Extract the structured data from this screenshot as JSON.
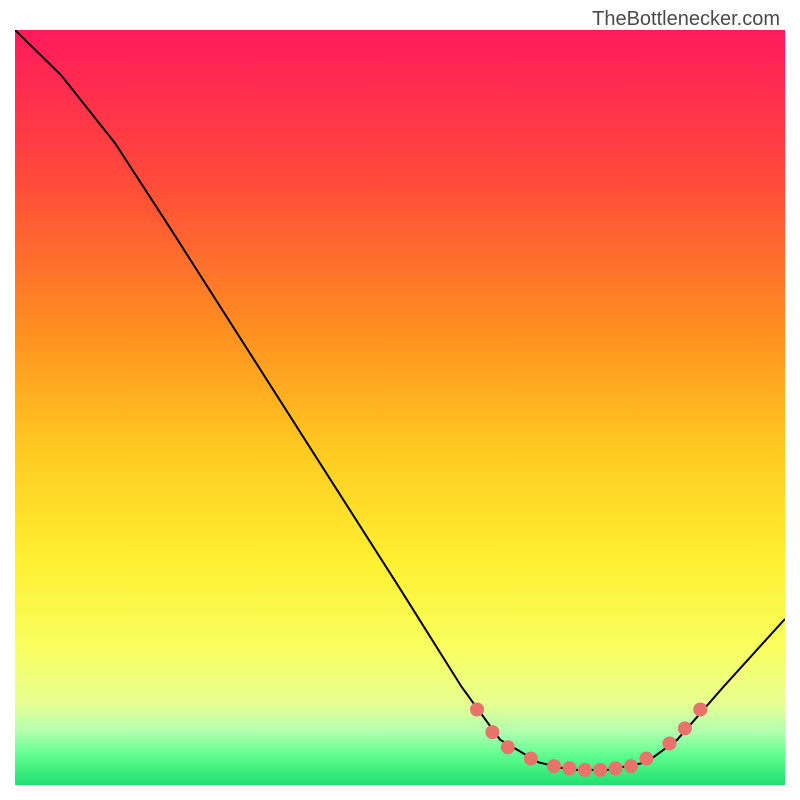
{
  "watermark": "TheBottlenecker.com",
  "chart_data": {
    "type": "line",
    "title": "",
    "xlabel": "",
    "ylabel": "",
    "xlim": [
      0,
      100
    ],
    "ylim": [
      0,
      100
    ],
    "curve": [
      {
        "x": 0,
        "y": 100
      },
      {
        "x": 6,
        "y": 94
      },
      {
        "x": 13,
        "y": 85
      },
      {
        "x": 20,
        "y": 74
      },
      {
        "x": 30,
        "y": 58
      },
      {
        "x": 40,
        "y": 42
      },
      {
        "x": 50,
        "y": 26
      },
      {
        "x": 58,
        "y": 13
      },
      {
        "x": 63,
        "y": 6
      },
      {
        "x": 68,
        "y": 3
      },
      {
        "x": 72,
        "y": 2
      },
      {
        "x": 77,
        "y": 2
      },
      {
        "x": 82,
        "y": 3
      },
      {
        "x": 86,
        "y": 6
      },
      {
        "x": 92,
        "y": 13
      },
      {
        "x": 100,
        "y": 22
      }
    ],
    "markers": [
      {
        "x": 60,
        "y": 10
      },
      {
        "x": 62,
        "y": 7
      },
      {
        "x": 64,
        "y": 5
      },
      {
        "x": 67,
        "y": 3.5
      },
      {
        "x": 70,
        "y": 2.5
      },
      {
        "x": 72,
        "y": 2.2
      },
      {
        "x": 74,
        "y": 2
      },
      {
        "x": 76,
        "y": 2
      },
      {
        "x": 78,
        "y": 2.2
      },
      {
        "x": 80,
        "y": 2.5
      },
      {
        "x": 82,
        "y": 3.5
      },
      {
        "x": 85,
        "y": 5.5
      },
      {
        "x": 87,
        "y": 7.5
      },
      {
        "x": 89,
        "y": 10
      }
    ],
    "gradient_stops": [
      {
        "offset": 0,
        "color": "#ff1a5c"
      },
      {
        "offset": 20,
        "color": "#ff4a3a"
      },
      {
        "offset": 40,
        "color": "#ff9020"
      },
      {
        "offset": 55,
        "color": "#ffc820"
      },
      {
        "offset": 70,
        "color": "#ffef30"
      },
      {
        "offset": 82,
        "color": "#f8ff60"
      },
      {
        "offset": 89,
        "color": "#e8ff90"
      },
      {
        "offset": 93,
        "color": "#b0ffb0"
      },
      {
        "offset": 96,
        "color": "#60ff90"
      },
      {
        "offset": 100,
        "color": "#20df70"
      }
    ],
    "marker_color": "#e8736b",
    "curve_color": "#000000"
  }
}
